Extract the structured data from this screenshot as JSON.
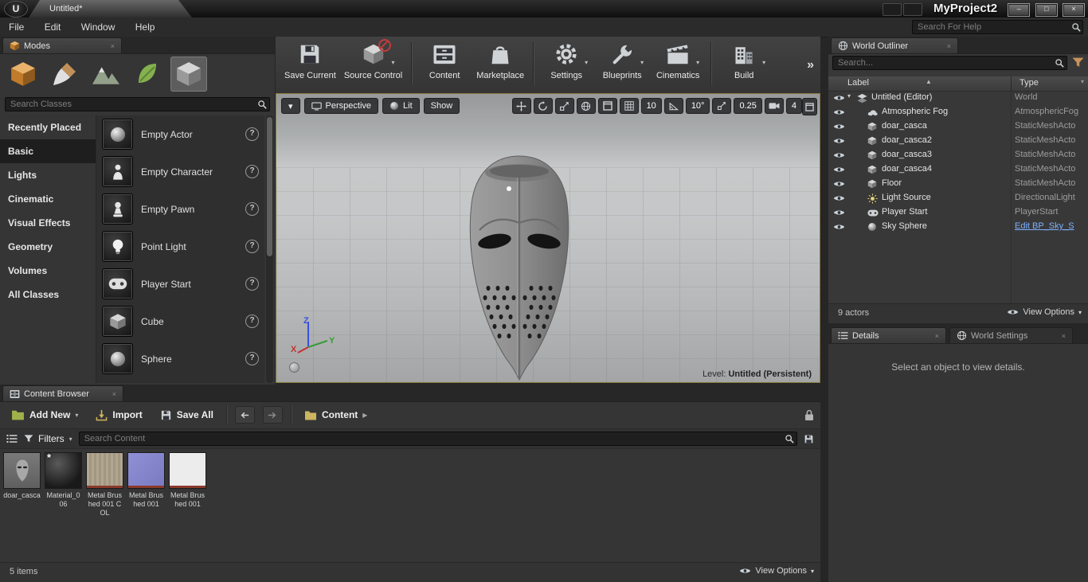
{
  "glyphs": {
    "close": "×",
    "caret_down": "▾",
    "caret_right": "▸",
    "sort_asc": "▲",
    "overflow": "»",
    "question": "?",
    "minimize": "–",
    "maximize": "□",
    "close_win": "×"
  },
  "window": {
    "tab": "Untitled*",
    "project": "MyProject2",
    "help_search_placeholder": "Search For Help",
    "logo": "U"
  },
  "menu": {
    "items": [
      {
        "label": "File"
      },
      {
        "label": "Edit"
      },
      {
        "label": "Window"
      },
      {
        "label": "Help"
      }
    ]
  },
  "modes": {
    "tab": "Modes",
    "search_placeholder": "Search Classes",
    "mode_tools": [
      {
        "name": "place"
      },
      {
        "name": "paint"
      },
      {
        "name": "landscape"
      },
      {
        "name": "foliage"
      },
      {
        "name": "geometry"
      }
    ],
    "selected_mode": "geometry",
    "categories": [
      {
        "label": "Recently Placed"
      },
      {
        "label": "Basic"
      },
      {
        "label": "Lights"
      },
      {
        "label": "Cinematic"
      },
      {
        "label": "Visual Effects"
      },
      {
        "label": "Geometry"
      },
      {
        "label": "Volumes"
      },
      {
        "label": "All Classes"
      }
    ],
    "selected_category": "Basic",
    "items": [
      {
        "label": "Empty Actor",
        "icon": "sphere-icon"
      },
      {
        "label": "Empty Character",
        "icon": "person-icon"
      },
      {
        "label": "Empty Pawn",
        "icon": "pawn-icon"
      },
      {
        "label": "Point Light",
        "icon": "bulb-icon"
      },
      {
        "label": "Player Start",
        "icon": "gamepad-icon"
      },
      {
        "label": "Cube",
        "icon": "cube-icon"
      },
      {
        "label": "Sphere",
        "icon": "sphere-icon"
      }
    ]
  },
  "toolbar": {
    "buttons": [
      {
        "label": "Save Current",
        "icon": "floppy-icon"
      },
      {
        "label": "Source Control",
        "icon": "source-control-icon",
        "dropdown": true
      },
      {
        "label": "Content",
        "icon": "drawer-icon"
      },
      {
        "label": "Marketplace",
        "icon": "bag-icon"
      },
      {
        "label": "Settings",
        "icon": "gear-icon",
        "dropdown": true
      },
      {
        "label": "Blueprints",
        "icon": "wrench-icon",
        "dropdown": true
      },
      {
        "label": "Cinematics",
        "icon": "clapper-icon",
        "dropdown": true
      },
      {
        "label": "Build",
        "icon": "building-icon",
        "dropdown": true
      }
    ]
  },
  "viewport": {
    "perspective": "Perspective",
    "lit": "Lit",
    "show": "Show",
    "grid_snap": "10",
    "angle_snap": "10°",
    "scale_snap": "0.25",
    "camera_speed": "4",
    "level_label": "Level:",
    "level_name": "Untitled (Persistent)",
    "axis_x": "X",
    "axis_y": "Y",
    "axis_z": "Z"
  },
  "outliner": {
    "title": "World Outliner",
    "search_placeholder": "Search...",
    "label_col": "Label",
    "type_col": "Type",
    "rows": [
      {
        "label": "Untitled (Editor)",
        "type": "World",
        "icon": "layers-icon"
      },
      {
        "label": "Atmospheric Fog",
        "type": "AtmosphericFog",
        "icon": "cloud-icon"
      },
      {
        "label": "doar_casca",
        "type": "StaticMeshActo",
        "icon": "cube-icon"
      },
      {
        "label": "doar_casca2",
        "type": "StaticMeshActo",
        "icon": "cube-icon"
      },
      {
        "label": "doar_casca3",
        "type": "StaticMeshActo",
        "icon": "cube-icon"
      },
      {
        "label": "doar_casca4",
        "type": "StaticMeshActo",
        "icon": "cube-icon"
      },
      {
        "label": "Floor",
        "type": "StaticMeshActo",
        "icon": "cube-icon"
      },
      {
        "label": "Light Source",
        "type": "DirectionalLight",
        "icon": "sun-icon"
      },
      {
        "label": "Player Start",
        "type": "PlayerStart",
        "icon": "gamepad-icon"
      },
      {
        "label": "Sky Sphere",
        "type": "Edit BP_Sky_S",
        "icon": "sphere-icon"
      }
    ],
    "actor_count": "9 actors",
    "view_options": "View Options"
  },
  "details": {
    "tab_details": "Details",
    "tab_world_settings": "World Settings",
    "empty_message": "Select an object to view details."
  },
  "content_browser": {
    "tab": "Content Browser",
    "add_new": "Add New",
    "import": "Import",
    "save_all": "Save All",
    "breadcrumb_root": "Content",
    "filters": "Filters",
    "search_placeholder": "Search Content",
    "assets": [
      {
        "name": "doar_casca",
        "kind": "static-mesh"
      },
      {
        "name": "Material_006",
        "kind": "material",
        "dirty": "*"
      },
      {
        "name": "Metal Brushed 001 COL",
        "kind": "texture"
      },
      {
        "name": "Metal Brushed 001",
        "kind": "texture-normal"
      },
      {
        "name": "Metal Brushed 001",
        "kind": "texture-white"
      }
    ],
    "item_count": "5 items",
    "view_options": "View Options"
  },
  "colors": {
    "accent_orange": "#e8a13a",
    "viewport_border": "#8a7a3a",
    "link_blue": "#7fb0ff",
    "texture_stripe": "#8a3a2a"
  }
}
